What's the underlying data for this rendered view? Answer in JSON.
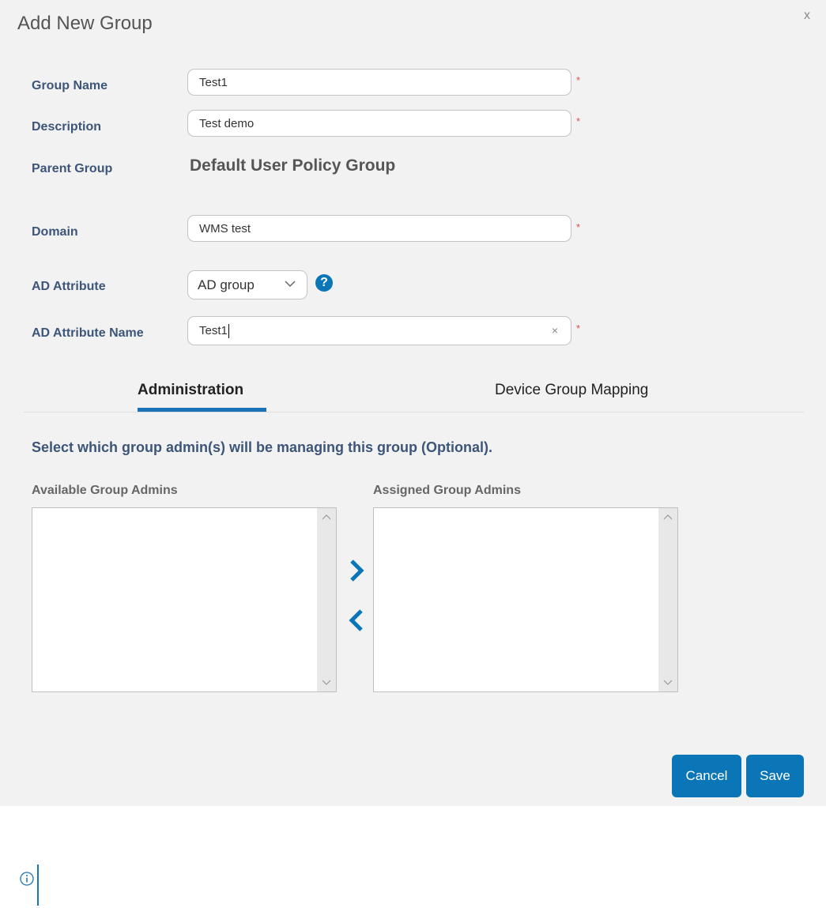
{
  "dialog": {
    "title": "Add New Group",
    "close_label": "x"
  },
  "form": {
    "group_name": {
      "label": "Group Name",
      "value": "Test1",
      "required": "*"
    },
    "description": {
      "label": "Description",
      "value": "Test demo",
      "required": "*"
    },
    "parent_group": {
      "label": "Parent Group",
      "value": "Default User Policy Group"
    },
    "domain": {
      "label": "Domain",
      "value": "WMS test",
      "required": "*"
    },
    "ad_attribute": {
      "label": "AD Attribute",
      "selected": "AD group"
    },
    "ad_attribute_name": {
      "label": "AD Attribute Name",
      "value": "Test1",
      "required": "*"
    }
  },
  "tabs": [
    {
      "label": "Administration",
      "active": true
    },
    {
      "label": "Device Group Mapping",
      "active": false
    }
  ],
  "admin": {
    "instruction": "Select which group admin(s) will be managing this group (Optional).",
    "available_label": "Available Group Admins",
    "assigned_label": "Assigned Group Admins"
  },
  "buttons": {
    "cancel": "Cancel",
    "save": "Save"
  },
  "icons": {
    "help": "?",
    "help_icon": "question-circle-icon",
    "info_icon": "info-circle-icon",
    "move_right_icon": "chevron-right-icon",
    "move_left_icon": "chevron-left-icon"
  },
  "colors": {
    "accent": "#0a76b7",
    "label": "#3d5578",
    "required": "#d9534f",
    "dialog_bg": "#f2f2f2"
  }
}
